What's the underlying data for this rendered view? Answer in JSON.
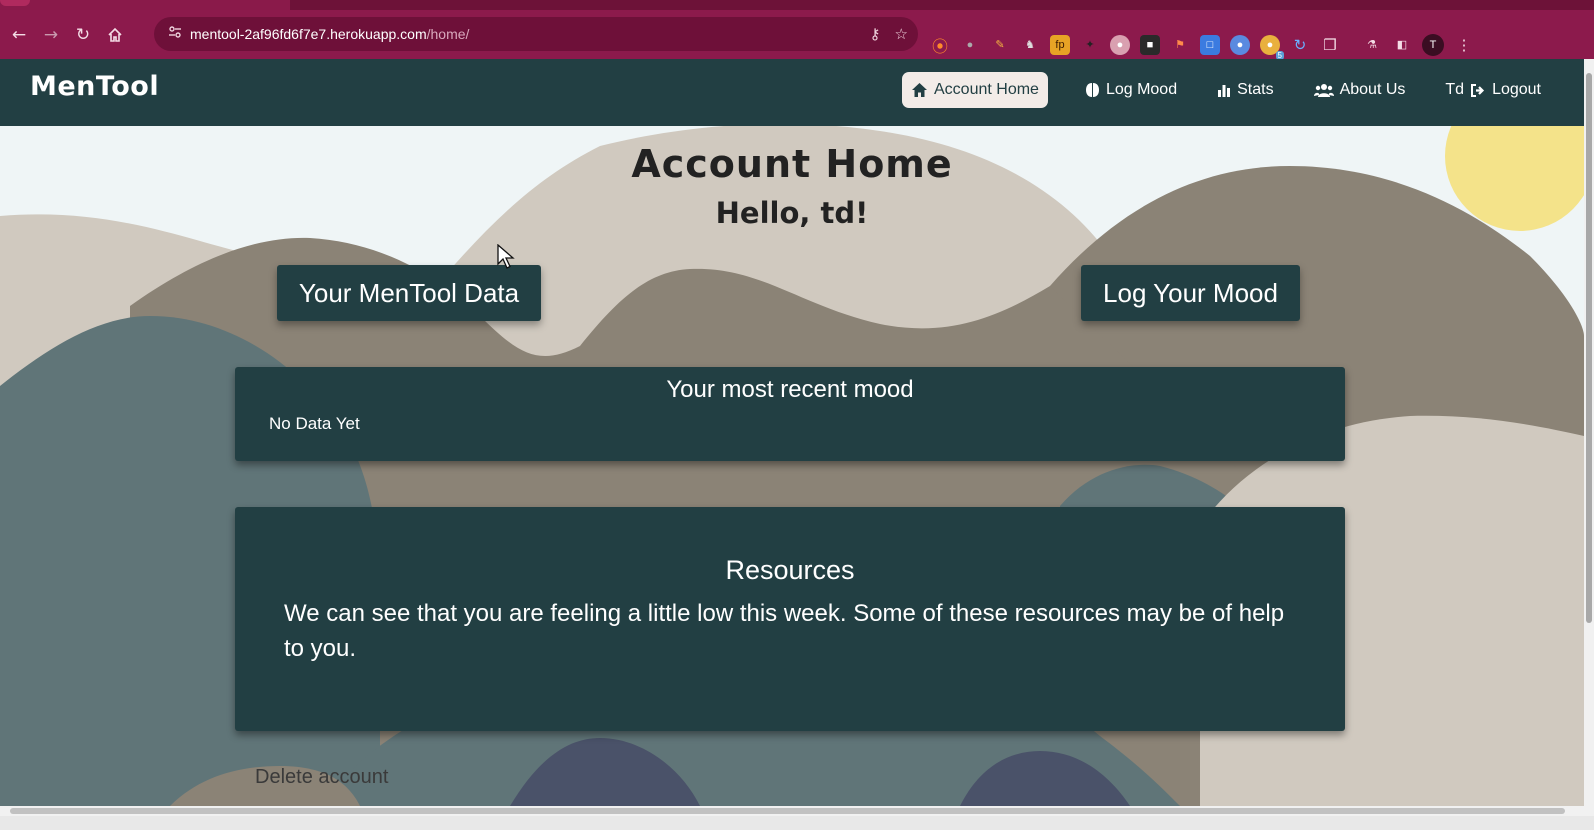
{
  "browser": {
    "url_host": "mentool-2af96fd6f7e7.herokuapp.com",
    "url_path": "/home/",
    "profile_initial": "T",
    "extension_badge": "5",
    "extension_fp_label": "fp"
  },
  "site": {
    "brand": "MenTool",
    "nav": {
      "account_home": "Account Home",
      "log_mood": "Log Mood",
      "stats": "Stats",
      "about_us": "About Us",
      "user": "Td",
      "logout": "Logout"
    },
    "icons": {
      "account_home": "home-icon",
      "log_mood": "brain-icon",
      "stats": "bar-chart-icon",
      "about_us": "users-icon",
      "logout": "logout-icon"
    }
  },
  "page": {
    "title": "Account Home",
    "greeting": "Hello, td!",
    "data_button": "Your MenTool Data",
    "log_button": "Log Your Mood",
    "recent_mood": {
      "title": "Your most recent mood",
      "value": "No Data Yet"
    },
    "resources": {
      "title": "Resources",
      "text": "We can see that you are feeling a little low this week. Some of these resources may be of help to you."
    },
    "delete_link": "Delete account"
  },
  "colors": {
    "browser_frame": "#8c1a4c",
    "nav_bg": "#223f43",
    "card_bg": "#223f43",
    "page_bg": "#eff5f6",
    "sun": "#f4e38a"
  }
}
